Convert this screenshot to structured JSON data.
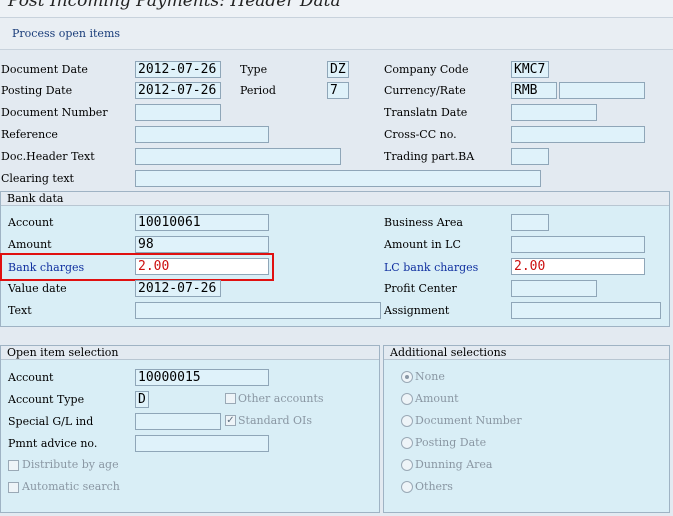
{
  "title": "Post Incoming Payments: Header Data",
  "toolbar": {
    "process_open_items": "Process open items"
  },
  "header": {
    "document_date_label": "Document Date",
    "document_date": "2012-07-26",
    "type_label": "Type",
    "type": "DZ",
    "company_code_label": "Company Code",
    "company_code": "KMC7",
    "posting_date_label": "Posting Date",
    "posting_date": "2012-07-26",
    "period_label": "Period",
    "period": "7",
    "currency_rate_label": "Currency/Rate",
    "currency": "RMB",
    "rate": "",
    "document_number_label": "Document Number",
    "document_number": "",
    "translatn_date_label": "Translatn Date",
    "translatn_date": "",
    "reference_label": "Reference",
    "reference": "",
    "cross_cc_label": "Cross-CC no.",
    "cross_cc": "",
    "doc_header_text_label": "Doc.Header Text",
    "doc_header_text": "",
    "trading_part_label": "Trading part.BA",
    "trading_part": "",
    "clearing_text_label": "Clearing text",
    "clearing_text": ""
  },
  "bank_data": {
    "title": "Bank data",
    "account_label": "Account",
    "account": "10010061",
    "business_area_label": "Business Area",
    "business_area": "",
    "amount_label": "Amount",
    "amount": "98",
    "amount_in_lc_label": "Amount in LC",
    "amount_in_lc": "",
    "bank_charges_label": "Bank charges",
    "bank_charges": "2.00",
    "lc_bank_charges_label": "LC bank charges",
    "lc_bank_charges": "2.00",
    "value_date_label": "Value date",
    "value_date": "2012-07-26",
    "profit_center_label": "Profit Center",
    "profit_center": "",
    "text_label": "Text",
    "text": "",
    "assignment_label": "Assignment",
    "assignment": ""
  },
  "open_item_selection": {
    "title": "Open item selection",
    "account_label": "Account",
    "account": "10000015",
    "account_type_label": "Account Type",
    "account_type": "D",
    "other_accounts_label": "Other accounts",
    "special_gl_label": "Special G/L ind",
    "special_gl": "",
    "standard_ois_label": "Standard OIs",
    "pmnt_advice_label": "Pmnt advice no.",
    "pmnt_advice": "",
    "distribute_by_age_label": "Distribute by age",
    "automatic_search_label": "Automatic search"
  },
  "additional_selections": {
    "title": "Additional selections",
    "options": [
      "None",
      "Amount",
      "Document Number",
      "Posting Date",
      "Dunning Area",
      "Others"
    ]
  },
  "colors": {
    "highlight": "#e01010",
    "field_bg": "#dff2fa",
    "label_blue": "#1030a0"
  }
}
